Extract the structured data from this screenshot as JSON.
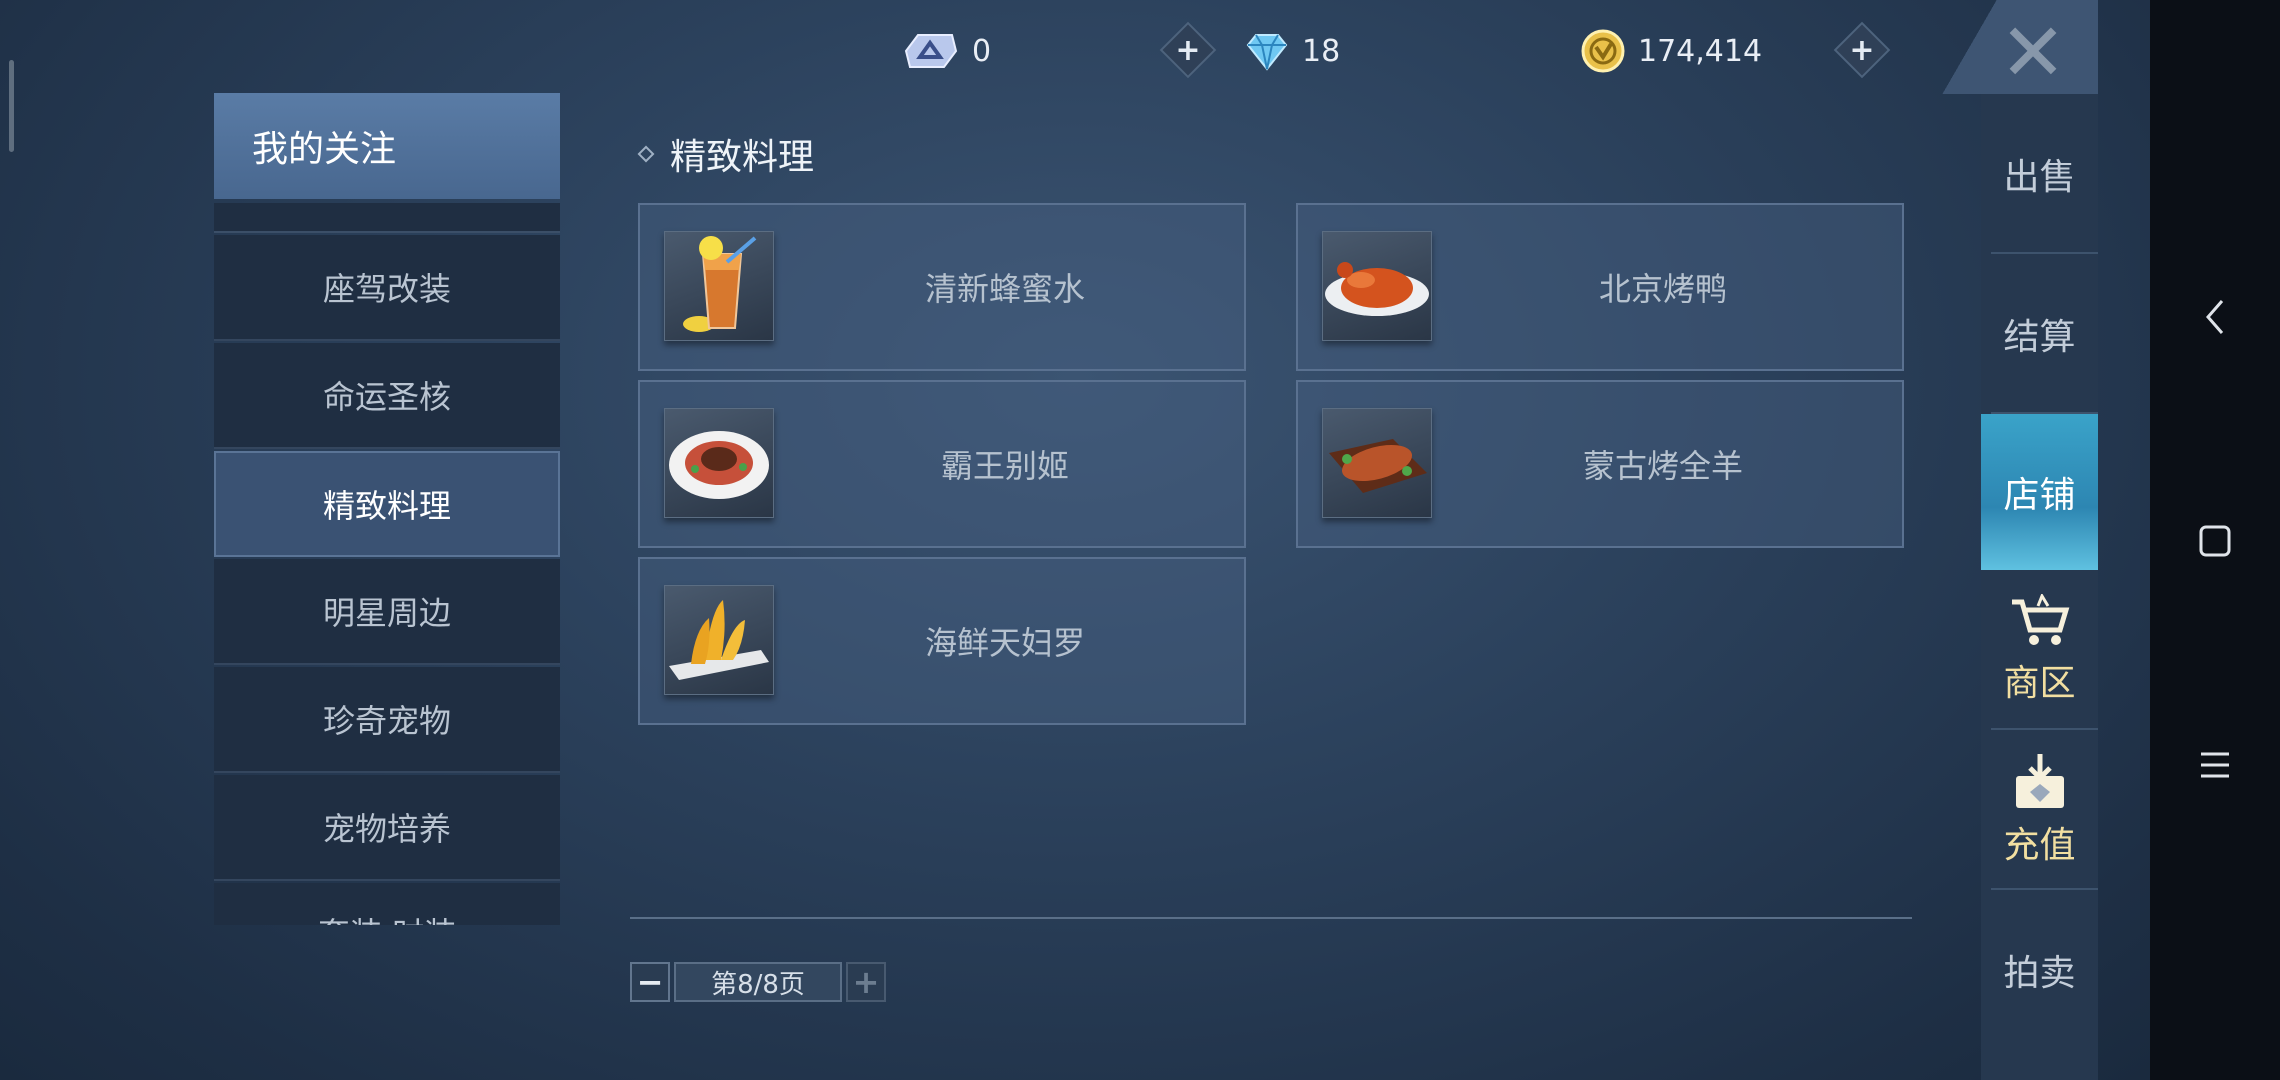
{
  "currency": {
    "ticket_value": "0",
    "diamond_value": "18",
    "gold_value": "174,414"
  },
  "sidebar": {
    "header": "我的关注",
    "items": [
      {
        "label": "座驾改装"
      },
      {
        "label": "命运圣核"
      },
      {
        "label": "精致料理",
        "active": true
      },
      {
        "label": "明星周边"
      },
      {
        "label": "珍奇宠物"
      },
      {
        "label": "宠物培养"
      },
      {
        "label": "套装·时装"
      }
    ]
  },
  "content": {
    "section_title": "精致料理",
    "items": [
      {
        "name": "清新蜂蜜水",
        "icon": "honey-water-icon"
      },
      {
        "name": "北京烤鸭",
        "icon": "roast-duck-icon"
      },
      {
        "name": "霸王别姬",
        "icon": "dish-plate-icon"
      },
      {
        "name": "蒙古烤全羊",
        "icon": "roast-lamb-icon"
      },
      {
        "name": "海鲜天妇罗",
        "icon": "tempura-icon"
      }
    ]
  },
  "pager": {
    "minus": "−",
    "label": "第8/8页",
    "plus": "+"
  },
  "right_tabs": {
    "sell": "出售",
    "checkout": "结算",
    "shop": "店铺",
    "market": "商区",
    "recharge": "充值",
    "auction": "拍卖"
  },
  "colors": {
    "active_tab": "#2d86b2",
    "gold_text": "#f2dfa1",
    "sidebar_header": "#5a7ca6"
  }
}
